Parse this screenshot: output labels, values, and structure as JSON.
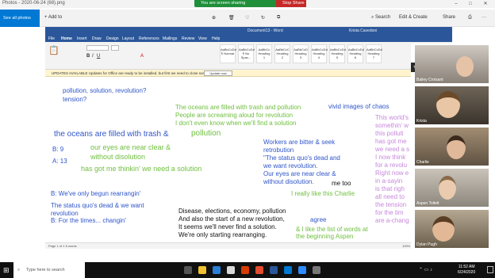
{
  "photos": {
    "title": "Photos - 2020-06-24 (68).png",
    "see_all": "See all photos",
    "add_to": "+ Add to",
    "search": "Search",
    "edit_create": "Edit & Create",
    "share": "Share"
  },
  "sharing": {
    "text": "You are screen sharing",
    "stop": "Stop Share"
  },
  "word": {
    "doc_title": "Document13 - Word",
    "user": "Krista Cavedoni",
    "tabs": [
      "File",
      "Home",
      "Insert",
      "Draw",
      "Design",
      "Layout",
      "References",
      "Mailings",
      "Review",
      "View",
      "Help"
    ],
    "styles": [
      "AaBbCcDd",
      "AaBbCcDd",
      "AaBbCc",
      "AaBbCcC",
      "AaBbCcD",
      "AaBbCcDd",
      "AaBbCcDd",
      "AaBbCcDd",
      "AaBbCcDd"
    ],
    "style_names": [
      "¶ Normal",
      "¶ No Spac...",
      "Heading 1",
      "Heading 2",
      "Heading 3",
      "Heading 4",
      "Heading 5",
      "Heading 6",
      "Heading 7"
    ],
    "update_label": "UPDATES AVAILABLE  Updates for Office are ready to be installed, but first we need to close some apps.",
    "update_button": "Update now",
    "status_left": "Page 1 of 1   6 words",
    "zoom": "100%"
  },
  "overlay": {
    "blue_1": "pollution, solution, revolution?",
    "blue_2": "tension?",
    "blue_3": "the oceans are filled with trash &",
    "blue_4": "B: 9",
    "blue_5": "A: 13",
    "blue_6": "B: We've only begun rearrangin'",
    "blue_7": "The status quo's dead & we want",
    "blue_8": "revolution",
    "blue_9": "B: For the times... changin'",
    "blue_10": "vivid images of chaos",
    "blue_11": "Workers are bitter & seek",
    "blue_12": "retrobution",
    "blue_13": "\"The status quo's dead and",
    "blue_14": "we want revolution.",
    "blue_15": "Our eyes are near clear &",
    "blue_16": "without disolution.",
    "blue_17": "agree",
    "black_me_too": "me too",
    "green_1": "The oceans are filled with trash and pollution",
    "green_2": "People are screaming aloud for revolution",
    "green_3": "I don't even know when we'll find a solution",
    "green_4": "pollution",
    "green_5": "our eyes are near clear &",
    "green_6": "without disolution",
    "green_7": "has got me thinkin' we need a  solution",
    "green_8": "I really like this Charlie",
    "green_9": "& I like the list of words at",
    "green_10": "the beginning Aspen",
    "black_1": "Disease, elections, economy, pollution",
    "black_2": "And also the start of a new revolution,",
    "black_3": "It seems we'll never find a solution.",
    "black_4": "We're only starting rearranging.",
    "purple": [
      "This world's",
      "somethin' w",
      "this polluti",
      "has got me",
      "we need a s",
      "I now think",
      "for a revolu",
      "Right now e",
      "in a-sayin",
      "is that righ",
      "all need to",
      "the tension",
      "for the tim",
      "are a-chang"
    ]
  },
  "participants": {
    "talking": "Talking: Aspen T",
    "names": [
      "Bailey Croisant",
      "Krista",
      "Charlie",
      "Aspen Tollett",
      "Dylan Pugh"
    ]
  },
  "taskbar": {
    "search_placeholder": "Type here to search",
    "time": "11:52 AM",
    "date": "6/24/2020"
  },
  "colors": {
    "word_blue": "#2b579a",
    "share_green": "#1f8f3a",
    "stop_red": "#c62828",
    "photos_accent": "#0078d4",
    "overlay_blue": "#2f55c9",
    "overlay_green": "#6fbf3f",
    "overlay_purple": "#c788dc"
  }
}
